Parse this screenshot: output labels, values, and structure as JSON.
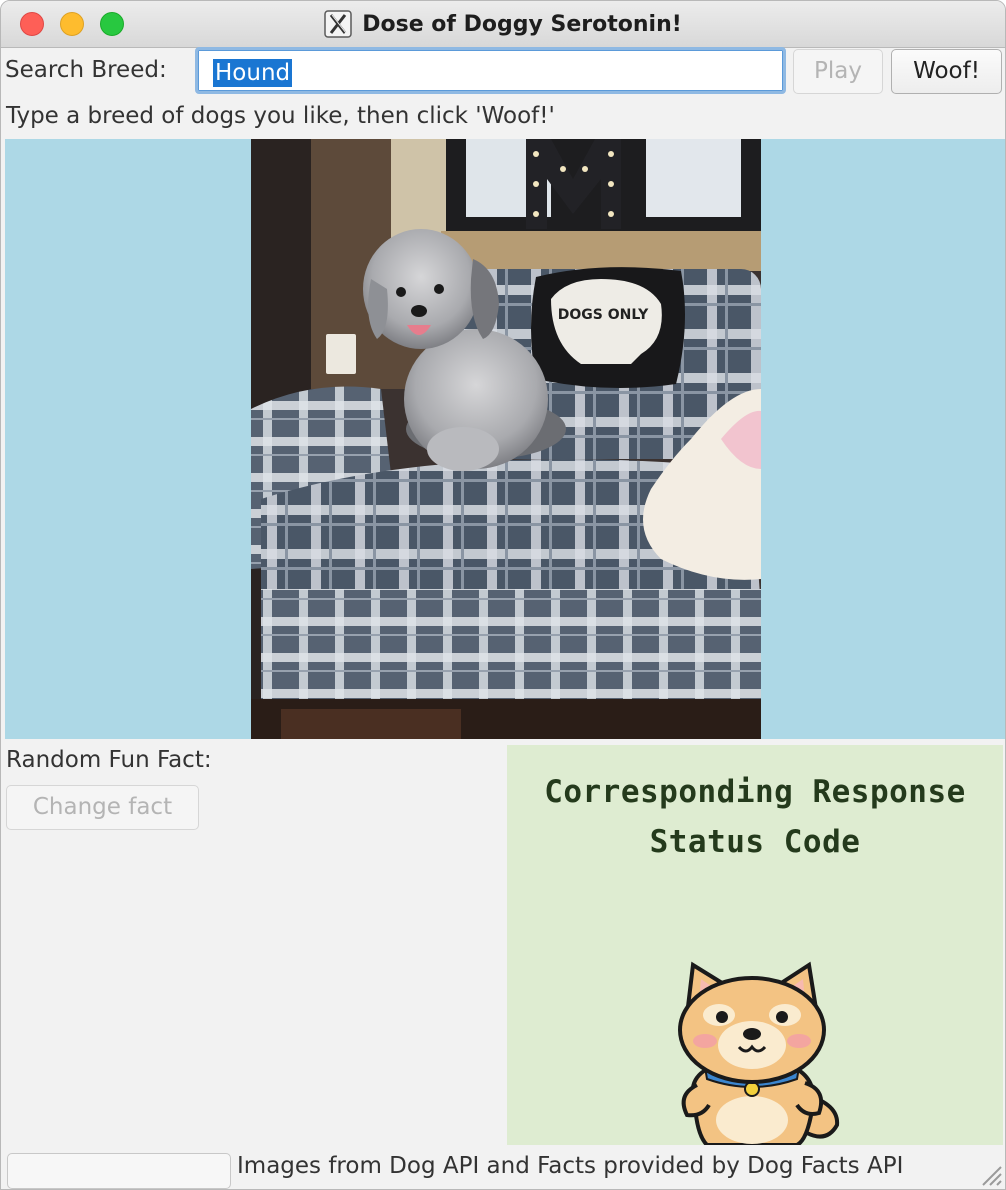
{
  "window": {
    "title": "Dose of Doggy Serotonin!"
  },
  "search": {
    "label": "Search Breed:",
    "value": "Hound",
    "play_label": "Play",
    "woof_label": "Woof!",
    "hint": "Type a breed of dogs you like, then click 'Woof!'"
  },
  "image_panel": {
    "background": "#add8e6",
    "sign_text": "DOGS ONLY"
  },
  "fact": {
    "label": "Random Fun Fact:",
    "change_label": "Change fact"
  },
  "status": {
    "title": "Corresponding Response Status Code"
  },
  "footer": {
    "credit": "Images from Dog API and Facts provided by Dog Facts API"
  }
}
